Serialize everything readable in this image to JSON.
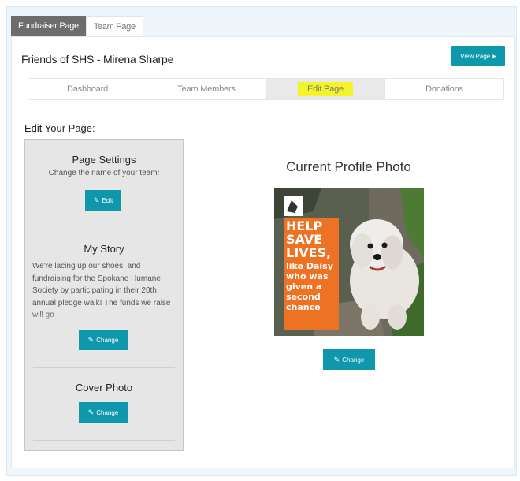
{
  "top_tabs": [
    {
      "label": "Fundraiser Page"
    },
    {
      "label": "Team Page"
    }
  ],
  "header": {
    "team_title": "Friends of SHS - Mirena Sharpe",
    "view_page_label": "View Page"
  },
  "subnav": [
    {
      "label": "Dashboard"
    },
    {
      "label": "Team Members"
    },
    {
      "label": "Edit Page"
    },
    {
      "label": "Donations"
    }
  ],
  "edit_heading": "Edit Your Page:",
  "sidebar": {
    "page_settings": {
      "title": "Page Settings",
      "subtitle": "Change the name of your team!",
      "button": "Edit"
    },
    "my_story": {
      "title": "My Story",
      "text": "We're lacing up our shoes, and fundraising for the Spokane Humane Society by participating in their 20th annual pledge walk! The funds we raise will go",
      "button": "Change"
    },
    "cover_photo": {
      "title": "Cover Photo",
      "button": "Change"
    }
  },
  "profile_photo": {
    "title": "Current Profile Photo",
    "poster_lines_bold": [
      "HELP",
      "SAVE",
      "LIVES,"
    ],
    "poster_lines": [
      "like Daisy",
      "who was",
      "given a",
      "second",
      "chance"
    ],
    "button": "Change"
  },
  "colors": {
    "accent": "#0f97ac",
    "highlight": "#f4f42a",
    "poster_orange": "#ee7223"
  }
}
